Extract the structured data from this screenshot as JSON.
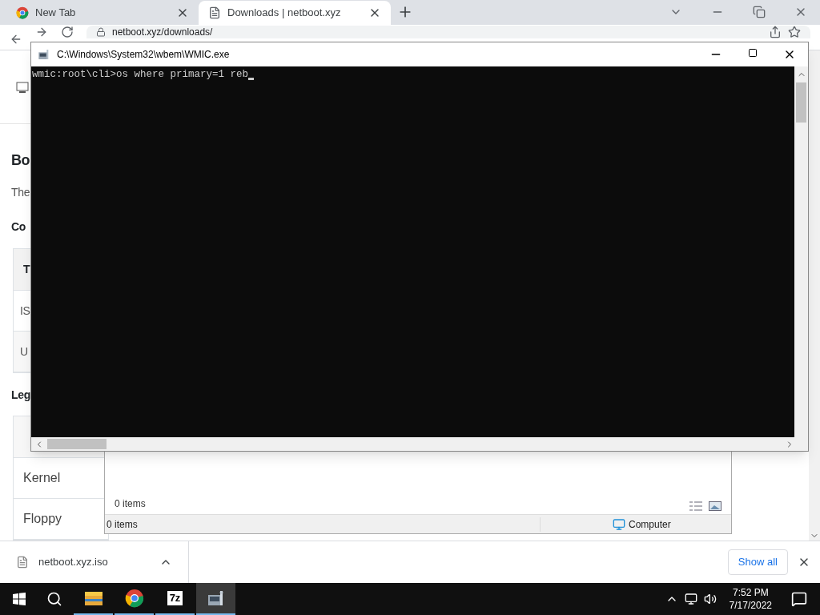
{
  "browser": {
    "tabs": [
      {
        "title": "New Tab",
        "kind": "chrome",
        "selected": false
      },
      {
        "title": "Downloads | netboot.xyz",
        "kind": "page",
        "selected": true
      }
    ],
    "address": "netboot.xyz/downloads/",
    "page": {
      "heading": "Bo",
      "intro": "The",
      "section_1": "Co",
      "table_1": {
        "header": "T",
        "rows": [
          "IS",
          "U"
        ]
      },
      "section_2": "Leg",
      "table_2": {
        "rows": [
          "Kernel",
          "Floppy"
        ]
      }
    },
    "download_bar": {
      "file": "netboot.xyz.iso",
      "show_all": "Show all"
    }
  },
  "explorer": {
    "items_count": "0 items",
    "status": "0 items",
    "location": "Computer"
  },
  "console": {
    "title": "C:\\Windows\\System32\\wbem\\WMIC.exe",
    "line": "wmic:root\\cli>os where primary=1 reb"
  },
  "taskbar": {
    "apps": [
      {
        "kind": "folder",
        "selected": false
      },
      {
        "kind": "chrome",
        "selected": false
      },
      {
        "kind": "archiver",
        "label": "7z",
        "selected": false
      },
      {
        "kind": "console",
        "selected": true
      }
    ],
    "time": "7:52 PM",
    "date": "7/17/2022"
  }
}
